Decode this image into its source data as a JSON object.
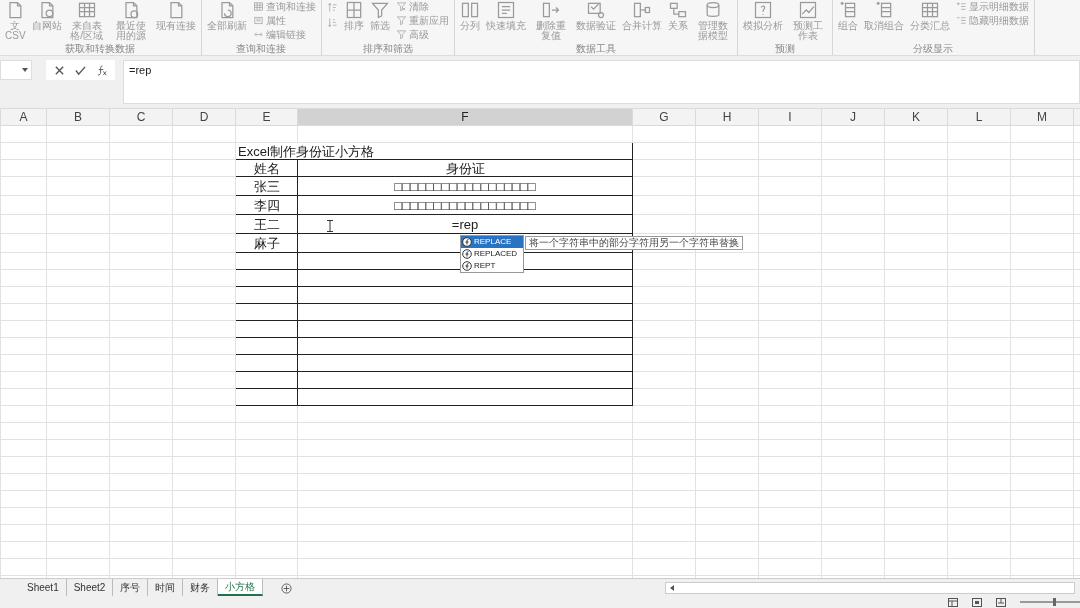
{
  "ribbon": {
    "groups": [
      {
        "label": "获取和转换数据",
        "items": [
          {
            "kind": "large",
            "label": "文\nCSV"
          },
          {
            "kind": "large",
            "label": "自网站"
          },
          {
            "kind": "large",
            "label": "来自表格/区域"
          },
          {
            "kind": "large",
            "label": "最近使用的源"
          },
          {
            "kind": "large",
            "label": "现有连接"
          }
        ]
      },
      {
        "label": "查询和连接",
        "items": [
          {
            "kind": "large",
            "label": "全部刷新"
          },
          {
            "kind": "stack",
            "items": [
              {
                "label": "查询和连接"
              },
              {
                "label": "属性"
              },
              {
                "label": "编辑链接"
              }
            ]
          }
        ]
      },
      {
        "label": "排序和筛选",
        "items": [
          {
            "kind": "sort_icons"
          },
          {
            "kind": "large",
            "label": "排序"
          },
          {
            "kind": "large",
            "label": "筛选"
          },
          {
            "kind": "stack",
            "items": [
              {
                "label": "清除"
              },
              {
                "label": "重新应用"
              },
              {
                "label": "高级"
              }
            ]
          }
        ]
      },
      {
        "label": "数据工具",
        "items": [
          {
            "kind": "large",
            "label": "分列"
          },
          {
            "kind": "large",
            "label": "快速填充"
          },
          {
            "kind": "large",
            "label": "删除重复值"
          },
          {
            "kind": "large",
            "label": "数据验证"
          },
          {
            "kind": "large",
            "label": "合并计算"
          },
          {
            "kind": "large",
            "label": "关系"
          },
          {
            "kind": "large",
            "label": "管理数据模型"
          }
        ]
      },
      {
        "label": "预测",
        "items": [
          {
            "kind": "large",
            "label": "模拟分析"
          },
          {
            "kind": "large",
            "label": "预测工作表"
          }
        ]
      },
      {
        "label": "分级显示",
        "items": [
          {
            "kind": "large",
            "label": "组合"
          },
          {
            "kind": "large",
            "label": "取消组合"
          },
          {
            "kind": "large",
            "label": "分类汇总"
          },
          {
            "kind": "stack",
            "items": [
              {
                "label": "显示明细数据"
              },
              {
                "label": "隐藏明细数据"
              }
            ]
          }
        ]
      }
    ]
  },
  "formula_bar": {
    "formula": "=rep"
  },
  "columns": [
    {
      "label": "A",
      "selected": false
    },
    {
      "label": "B",
      "selected": false
    },
    {
      "label": "C",
      "selected": false
    },
    {
      "label": "D",
      "selected": false
    },
    {
      "label": "E",
      "selected": false
    },
    {
      "label": "F",
      "selected": true
    },
    {
      "label": "G",
      "selected": false
    },
    {
      "label": "H",
      "selected": false
    },
    {
      "label": "I",
      "selected": false
    },
    {
      "label": "J",
      "selected": false
    },
    {
      "label": "K",
      "selected": false
    },
    {
      "label": "L",
      "selected": false
    },
    {
      "label": "M",
      "selected": false
    }
  ],
  "table": {
    "title": "Excel制作身份证小方格",
    "headers": [
      "姓名",
      "身份证"
    ],
    "rows": [
      {
        "name": "张三",
        "id": "□□□□□□□□□□□□□□□□□□"
      },
      {
        "name": "李四",
        "id": "□□□□□□□□□□□□□□□□□□"
      },
      {
        "name": "王二",
        "id": "=rep"
      },
      {
        "name": "麻子"
      }
    ]
  },
  "autocomplete": {
    "items": [
      {
        "label": "REPLACE",
        "selected": true
      },
      {
        "label": "REPLACED",
        "selected": false
      },
      {
        "label": "REPT",
        "selected": false
      }
    ],
    "tooltip": "将一个字符串中的部分字符用另一个字符串替换"
  },
  "sheet_tabs": [
    {
      "label": "Sheet1",
      "selected": false
    },
    {
      "label": "Sheet2",
      "selected": false
    },
    {
      "label": "序号",
      "selected": false
    },
    {
      "label": "时间",
      "selected": false
    },
    {
      "label": "财务",
      "selected": false
    },
    {
      "label": "小方格",
      "selected": true
    }
  ],
  "status_bar": {
    "zoom_slider": {
      "level": 0.55
    }
  }
}
